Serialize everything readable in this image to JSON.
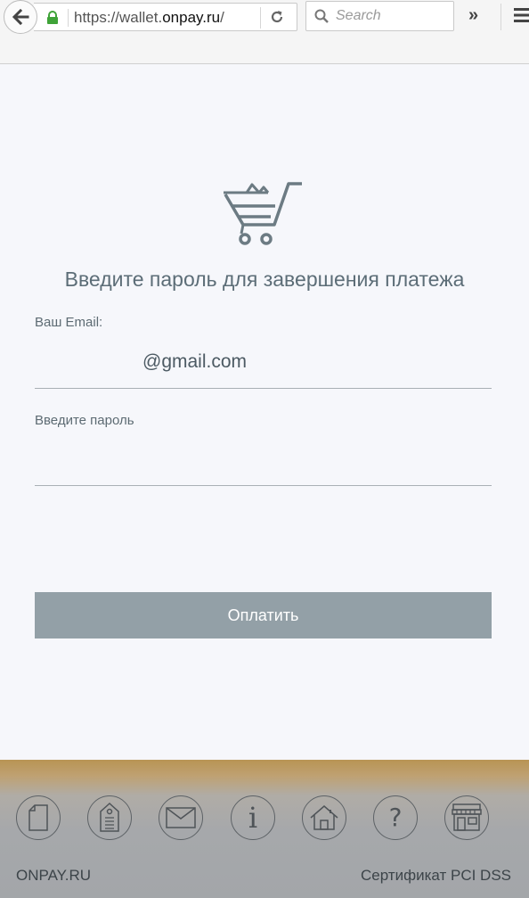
{
  "browser": {
    "url_prefix": "https://wallet.",
    "url_host": "onpay.ru",
    "url_suffix": "/",
    "search_placeholder": "Search",
    "overflow_label": "»"
  },
  "form": {
    "title": "Введите пароль для завершения платежа",
    "email_label": "Ваш Email:",
    "email_value": "@gmail.com",
    "password_label": "Введите пароль",
    "password_value": "",
    "submit_label": "Оплатить"
  },
  "footer": {
    "icons": [
      "document-icon",
      "price-tag-icon",
      "mail-icon",
      "info-icon",
      "home-icon",
      "help-icon",
      "shop-icon"
    ],
    "info_glyph": "i",
    "help_glyph": "?",
    "brand": "ONPAY.RU",
    "certificate": "Сертификат PCI DSS"
  },
  "colors": {
    "background": "#f6f7fb",
    "text": "#5c6d77",
    "button": "#93a0a7",
    "lock": "#3fa338"
  }
}
